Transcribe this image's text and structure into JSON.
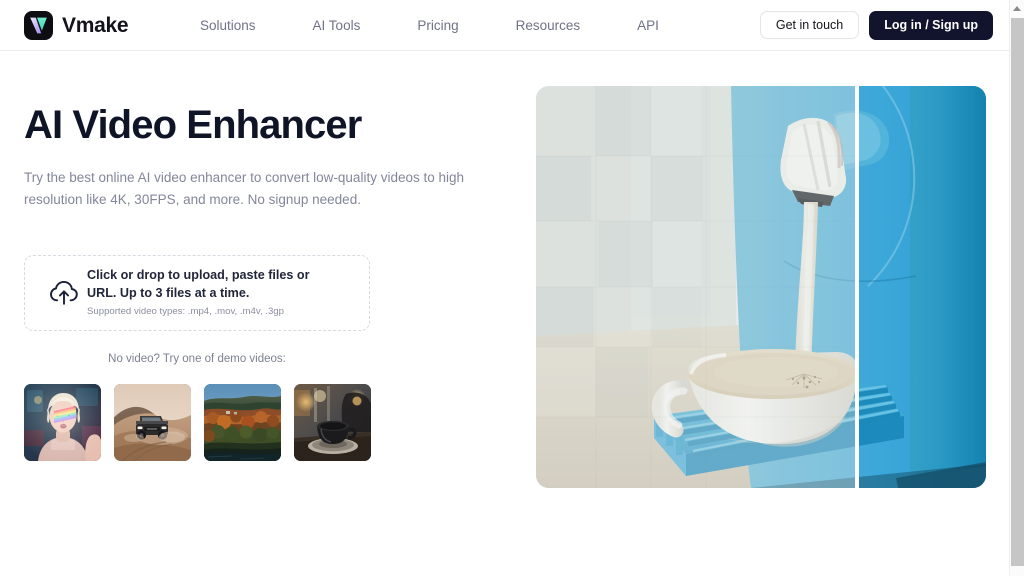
{
  "header": {
    "brand_name": "Vmake",
    "brand_icon": "vmake-logo-icon",
    "nav": [
      {
        "label": "Solutions"
      },
      {
        "label": "AI Tools"
      },
      {
        "label": "Pricing"
      },
      {
        "label": "Resources"
      },
      {
        "label": "API"
      }
    ],
    "contact_button": "Get in touch",
    "auth_button": "Log in / Sign up"
  },
  "hero": {
    "title": "AI Video Enhancer",
    "subtitle": "Try the best online AI video enhancer to convert low-quality videos to high resolution like 4K, 30FPS, and more. No signup needed.",
    "image_alt": "coffee-machine-pouring-into-white-cup-before-after-comparison",
    "comparison_divider": true
  },
  "upload": {
    "icon": "cloud-upload-icon",
    "primary_text": "Click or drop to upload, paste files or URL. Up to 3 files at a time.",
    "supported_text": "Supported video types: .mp4, .mov, .m4v, .3gp"
  },
  "demos": {
    "label": "No video? Try one of demo videos:",
    "items": [
      {
        "name": "demo-video-portrait-blonde"
      },
      {
        "name": "demo-video-desert-truck"
      },
      {
        "name": "demo-video-autumn-forest"
      },
      {
        "name": "demo-video-coffee-cup"
      }
    ]
  },
  "scrollbar": {
    "up_arrow_icon": "scroll-up-arrow-icon"
  },
  "colors": {
    "brand_dark": "#11142c",
    "text_primary": "#101427",
    "text_muted": "#83869b",
    "nav_link": "#6f7288",
    "border_light": "#e4e4ea",
    "dropzone_border": "#d9d9e2",
    "accent_mint": "#5ee8c4",
    "accent_lavender": "#b9a7f0"
  }
}
